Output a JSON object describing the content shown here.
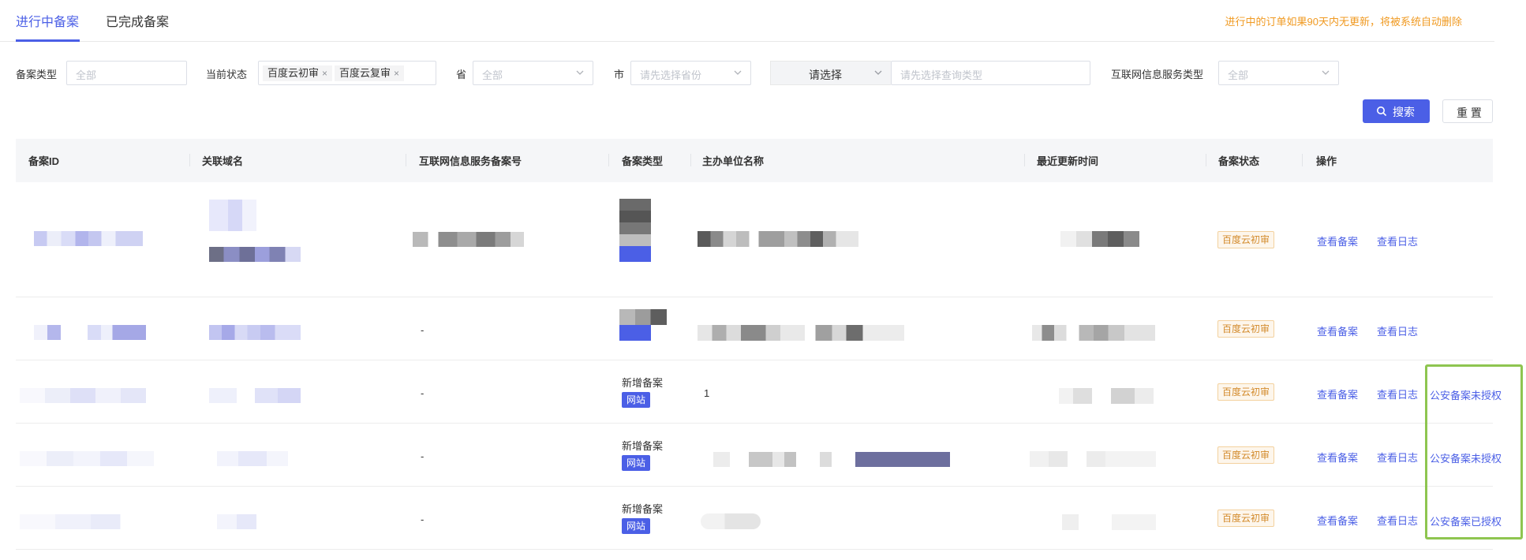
{
  "tabs": [
    {
      "label": "进行中备案",
      "active": true
    },
    {
      "label": "已完成备案",
      "active": false
    }
  ],
  "notice": "进行中的订单如果90天内无更新，将被系统自动删除",
  "filters": {
    "record_type": {
      "label": "备案类型",
      "placeholder": "全部"
    },
    "current_status": {
      "label": "当前状态",
      "tags": [
        "百度云初审",
        "百度云复审"
      ]
    },
    "province": {
      "label": "省",
      "placeholder": "全部"
    },
    "city": {
      "label": "市",
      "placeholder": "请先选择省份"
    },
    "query": {
      "type_value": "请选择",
      "placeholder": "请先选择查询类型"
    },
    "service_type": {
      "label": "互联网信息服务类型",
      "placeholder": "全部"
    }
  },
  "buttons": {
    "search": "搜索",
    "reset": "重 置"
  },
  "table": {
    "columns": [
      "备案ID",
      "关联域名",
      "互联网信息服务备案号",
      "备案类型",
      "主办单位名称",
      "最近更新时间",
      "备案状态",
      "操作"
    ],
    "rows": [
      {
        "service_no": "",
        "type_title": "",
        "type_tag": "",
        "org": "",
        "status": "百度云初审",
        "actions": [
          "查看备案",
          "查看日志"
        ]
      },
      {
        "service_no": "-",
        "type_title": "",
        "type_tag": "",
        "org": "",
        "status": "百度云初审",
        "actions": [
          "查看备案",
          "查看日志"
        ]
      },
      {
        "service_no": "-",
        "type_title": "新增备案",
        "type_tag": "网站",
        "org": "1",
        "status": "百度云初审",
        "actions": [
          "查看备案",
          "查看日志",
          "公安备案未授权"
        ]
      },
      {
        "service_no": "-",
        "type_title": "新增备案",
        "type_tag": "网站",
        "org": "",
        "status": "百度云初审",
        "actions": [
          "查看备案",
          "查看日志",
          "公安备案未授权"
        ]
      },
      {
        "service_no": "-",
        "type_title": "新增备案",
        "type_tag": "网站",
        "org": "",
        "status": "百度云初审",
        "actions": [
          "查看备案",
          "查看日志",
          "公安备案已授权"
        ]
      }
    ]
  },
  "colors": {
    "accent": "#4b5fe6",
    "notice": "#f09a22",
    "status_text": "#d38b2c",
    "highlight": "#8ec550"
  },
  "icons": {
    "search": "search-icon",
    "chevron": "chevron-down-icon",
    "tag_close": "close-icon"
  }
}
